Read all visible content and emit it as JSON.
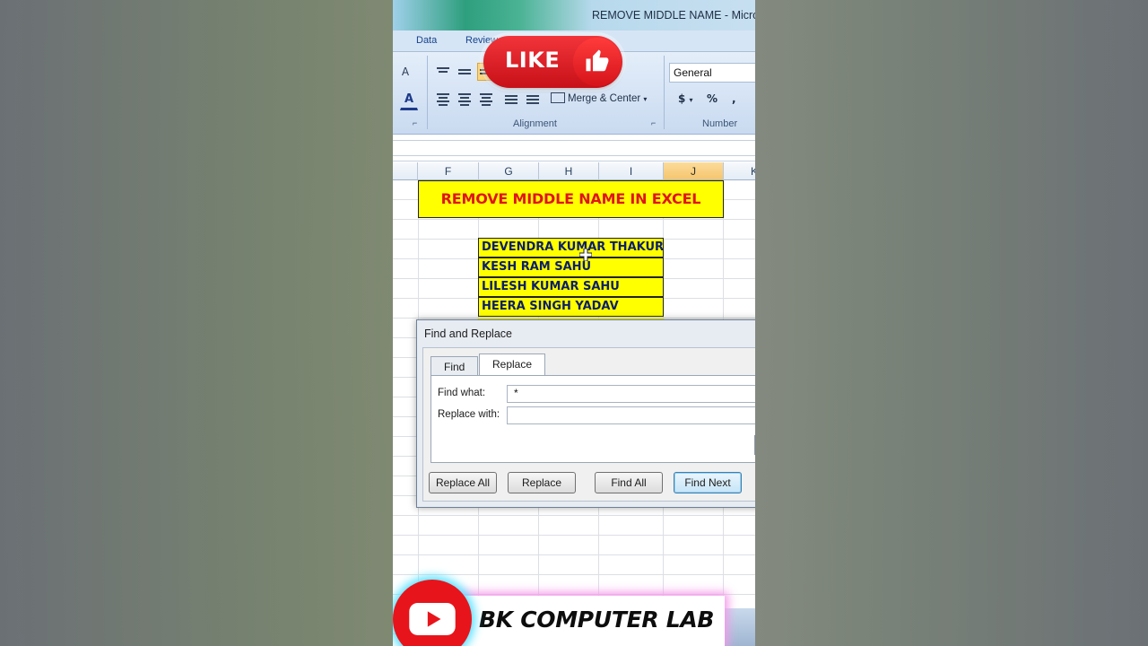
{
  "window": {
    "title": "REMOVE MIDDLE NAME - Micros"
  },
  "menu": {
    "items": [
      "Data",
      "Review"
    ]
  },
  "ribbon": {
    "alignment_label": "Alignment",
    "number_label": "Number",
    "merge_center_label": "Merge & Center",
    "number_format": "General",
    "currency_symbol": "$",
    "percent_symbol": "%",
    "comma_symbol": ","
  },
  "columns": [
    "F",
    "G",
    "H",
    "I",
    "J",
    "K"
  ],
  "sheet": {
    "banner": "REMOVE MIDDLE NAME IN EXCEL",
    "names": [
      "DEVENDRA KUMAR THAKUR",
      "KESH RAM SAHU",
      "LILESH KUMAR SAHU",
      "HEERA SINGH YADAV"
    ]
  },
  "dialog": {
    "title": "Find and Replace",
    "tabs": [
      "Find",
      "Replace"
    ],
    "active_tab": "Replace",
    "find_what_label": "Find what:",
    "find_what_value": "*",
    "replace_with_label": "Replace with:",
    "replace_with_value": "",
    "buttons": [
      "Replace All",
      "Replace",
      "Find All",
      "Find Next"
    ]
  },
  "overlay": {
    "like_text": "LIKE",
    "channel_name": "BK COMPUTER LAB"
  },
  "colors": {
    "banner_text": "#e0141b",
    "cell_fill": "#ffff00",
    "name_text": "#0b1f6a",
    "like_red": "#e8141b"
  },
  "icons": [
    "thumbs-up-icon",
    "youtube-play-icon",
    "cell-cursor-icon"
  ]
}
